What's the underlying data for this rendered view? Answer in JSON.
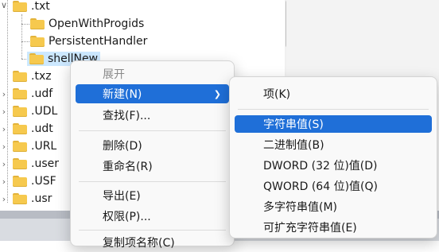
{
  "tree": {
    "items": [
      {
        "label": ".txt",
        "expanded": true
      },
      {
        "label": "OpenWithProgids"
      },
      {
        "label": "PersistentHandler"
      },
      {
        "label": "shellNew",
        "selected": true
      },
      {
        "label": ".txz"
      },
      {
        "label": ".udf"
      },
      {
        "label": ".UDL"
      },
      {
        "label": ".udt"
      },
      {
        "label": ".URL"
      },
      {
        "label": ".user"
      },
      {
        "label": ".USF"
      },
      {
        "label": ".usr"
      }
    ]
  },
  "context_menu": {
    "items": [
      {
        "label": "展开",
        "disabled": true
      },
      {
        "label": "新建(N)",
        "highlighted": true,
        "submenu": true
      },
      {
        "label": "查找(F)..."
      },
      {
        "label": "删除(D)"
      },
      {
        "label": "重命名(R)"
      },
      {
        "label": "导出(E)"
      },
      {
        "label": "权限(P)..."
      },
      {
        "label": "复制项名称(C)"
      }
    ]
  },
  "submenu": {
    "items": [
      {
        "label": "项(K)"
      },
      {
        "label": "字符串值(S)",
        "highlighted": true
      },
      {
        "label": "二进制值(B)"
      },
      {
        "label": "DWORD (32 位)值(D)"
      },
      {
        "label": "QWORD (64 位)值(Q)"
      },
      {
        "label": "多字符串值(M)"
      },
      {
        "label": "可扩充字符串值(E)"
      }
    ]
  },
  "colors": {
    "highlight": "#1f6fd8",
    "folder": "#f6c94e",
    "selection": "#cce8ff"
  }
}
